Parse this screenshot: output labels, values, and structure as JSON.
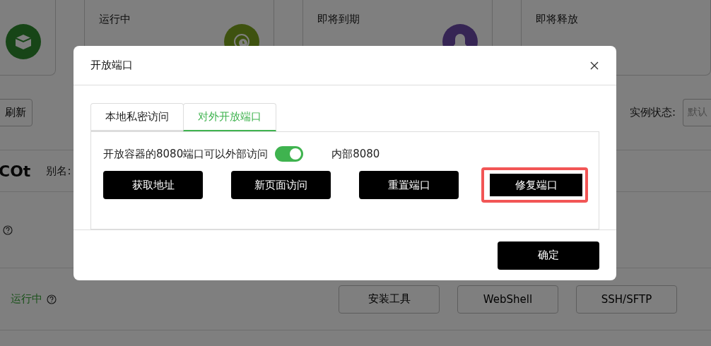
{
  "stat_cards": [
    {
      "kind": "icon"
    },
    {
      "kind": "labelled",
      "label": "运行中"
    },
    {
      "kind": "labelled",
      "label": "即将到期"
    },
    {
      "kind": "labelled",
      "label": "即将释放"
    }
  ],
  "toolbar": {
    "refresh_button": "刷新",
    "status_label": "实例状态:",
    "status_select": "默认"
  },
  "instance": {
    "name": "COt",
    "alias_label": "别名:",
    "status": "运行中",
    "actions": [
      "安装工具",
      "WebShell",
      "SSH/SFTP"
    ]
  },
  "dialog": {
    "title": "开放端口",
    "tabs": [
      {
        "label": "本地私密访问",
        "selected": false
      },
      {
        "label": "对外开放端口",
        "selected": true
      }
    ],
    "port_text": "开放容器的8080端口可以外部访问",
    "port_switch": {
      "on": true
    },
    "internal_port": "内部8080",
    "buttons": [
      {
        "label": "获取地址",
        "highlighted": false
      },
      {
        "label": "新页面访问",
        "highlighted": false
      },
      {
        "label": "重置端口",
        "highlighted": false
      },
      {
        "label": "修复端口",
        "highlighted": true
      }
    ],
    "confirm_button": "确定"
  }
}
